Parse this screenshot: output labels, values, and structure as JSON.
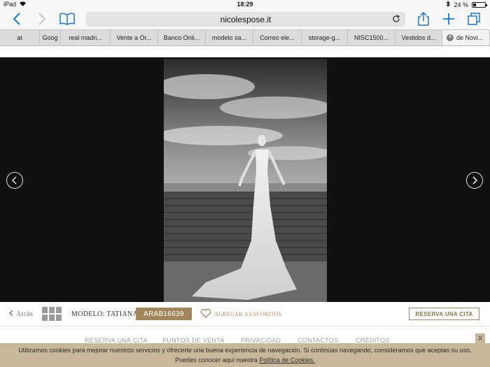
{
  "status_bar": {
    "device": "iPad",
    "time": "18:29",
    "battery": "24 %",
    "battery_level": 0.24
  },
  "toolbar": {
    "url": "nicolespose.it"
  },
  "bookmarks": [
    "at",
    "Goog",
    "real madri...",
    "Vente a Or...",
    "Banco Onli...",
    "modelo sa...",
    "Correo ele...",
    "storage-g...",
    "NISC1500...",
    "Vestidos d...",
    "de Novi..."
  ],
  "info_bar": {
    "back_label": "Atrás",
    "model_label": "MODELO: TATIANA",
    "model_code": "ARAB16639",
    "favorites_label": "AGREGAR A FAVORITOS",
    "reserve_label": "RESERVA UNA CITA"
  },
  "footer_nav": [
    "RESERVA UNA CITA",
    "PUNTOS DE VENTA",
    "PRIVACIDAD",
    "CONTACTOS",
    "CRÉDITOS"
  ],
  "cookie": {
    "line1": "Utilizamos cookies para mejorar nuestros servicios y ofrecerte una buena experiencia de navegación. Si continúas navegando, consideramos que aceptas su uso.",
    "line2_prefix": "Puedes conocer aquí nuestra ",
    "link": "Política de Cookies.",
    "close": "X"
  },
  "colors": {
    "accent_gold": "#a38659",
    "cookie_bg": "#c7b899",
    "ios_blue": "#1a76d2"
  },
  "icons": [
    "wifi-icon",
    "bluetooth-icon",
    "battery-icon",
    "back-icon",
    "forward-icon",
    "bookmarks-icon",
    "reload-icon",
    "share-icon",
    "plus-icon",
    "tabs-icon",
    "prev-arrow-icon",
    "next-arrow-icon",
    "grid-icon",
    "heart-icon"
  ]
}
